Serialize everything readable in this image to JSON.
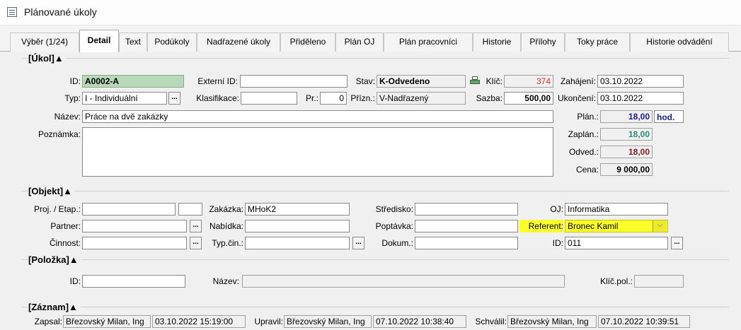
{
  "window": {
    "title": "Plánované úkoly",
    "icon": "form-icon"
  },
  "tabs": [
    {
      "label": "Výběr (1/24)"
    },
    {
      "label": "Detail",
      "active": true
    },
    {
      "label": "Text"
    },
    {
      "label": "Podúkoly"
    },
    {
      "label": "Nadřazené úkoly"
    },
    {
      "label": "Přiděleno"
    },
    {
      "label": "Plán OJ"
    },
    {
      "label": "Plán pracovníci"
    },
    {
      "label": "Historie"
    },
    {
      "label": "Přílohy"
    },
    {
      "label": "Toky práce"
    },
    {
      "label": "Historie odvádění"
    }
  ],
  "ukol": {
    "section_title": "[Úkol]▲",
    "id_label": "ID:",
    "id_value": "A0002-A",
    "externi_id_label": "Externí ID:",
    "externi_id_value": "",
    "stav_label": "Stav:",
    "stav_value": "K-Odvedeno",
    "klic_label": "Klíč:",
    "klic_value": "374",
    "zahajeni_label": "Zahájení:",
    "zahajeni_value": "03.10.2022",
    "typ_label": "Typ:",
    "typ_value": "I - Individuální",
    "klasifikace_label": "Klasifikace:",
    "klasifikace_value": "",
    "pr_label": "Pr.:",
    "pr_value": "0",
    "prizn_label": "Přízn.:",
    "prizn_value": "V-Nadřazený",
    "sazba_label": "Sazba:",
    "sazba_value": "500,00",
    "ukonceni_label": "Ukončení:",
    "ukonceni_value": "03.10.2022",
    "nazev_label": "Název:",
    "nazev_value": "Práce na dvě zakázky",
    "plan_label": "Plán.:",
    "plan_value": "18,00",
    "plan_unit": "hod.",
    "poznamka_label": "Poznámka:",
    "poznamka_value": "",
    "zaplan_label": "Zaplán.:",
    "zaplan_value": "18,00",
    "odved_label": "Odved.:",
    "odved_value": "18,00",
    "cena_label": "Cena:",
    "cena_value": "9 000,00"
  },
  "objekt": {
    "section_title": "[Objekt]▲",
    "proj_label": "Proj. / Etap.:",
    "proj_value": "",
    "etap_value": "",
    "zakazka_label": "Zakázka:",
    "zakazka_value": "MHoK2",
    "stredisko_label": "Středisko:",
    "stredisko_value": "",
    "oj_label": "OJ:",
    "oj_value": "Informatika",
    "partner_label": "Partner:",
    "partner_value": "",
    "nabidka_label": "Nabídka:",
    "nabidka_value": "",
    "poptavka_label": "Poptávka:",
    "poptavka_value": "",
    "referent_label": "Referent:",
    "referent_value": "Bronec Kamil",
    "cinnost_label": "Činnost:",
    "cinnost_value": "",
    "typcin_label": "Typ.čin.:",
    "typcin_value": "",
    "dokum_label": "Dokum.:",
    "dokum_value": "",
    "id_label": "ID:",
    "id_value": "011"
  },
  "polozka": {
    "section_title": "[Položka]▲",
    "id_label": "ID:",
    "id_value": "",
    "nazev_label": "Název:",
    "nazev_value": "",
    "klicpol_label": "Klíč.pol.:",
    "klicpol_value": ""
  },
  "zaznam": {
    "section_title": "[Záznam]▲",
    "zapsal_label": "Zapsal:",
    "zapsal_user": "Březovský Milan, Ing",
    "zapsal_date": "03.10.2022 15:19:00",
    "upravil_label": "Upravil:",
    "upravil_user": "Březovský Milan, Ing",
    "upravil_date": "07.10.2022 10:38:40",
    "schvalil_label": "Schválil:",
    "schvalil_user": "Březovský Milan, Ing",
    "schvalil_date": "07.10.2022 10:39:51"
  },
  "ellipsis": "...",
  "dropdown_glyph": "⌵"
}
